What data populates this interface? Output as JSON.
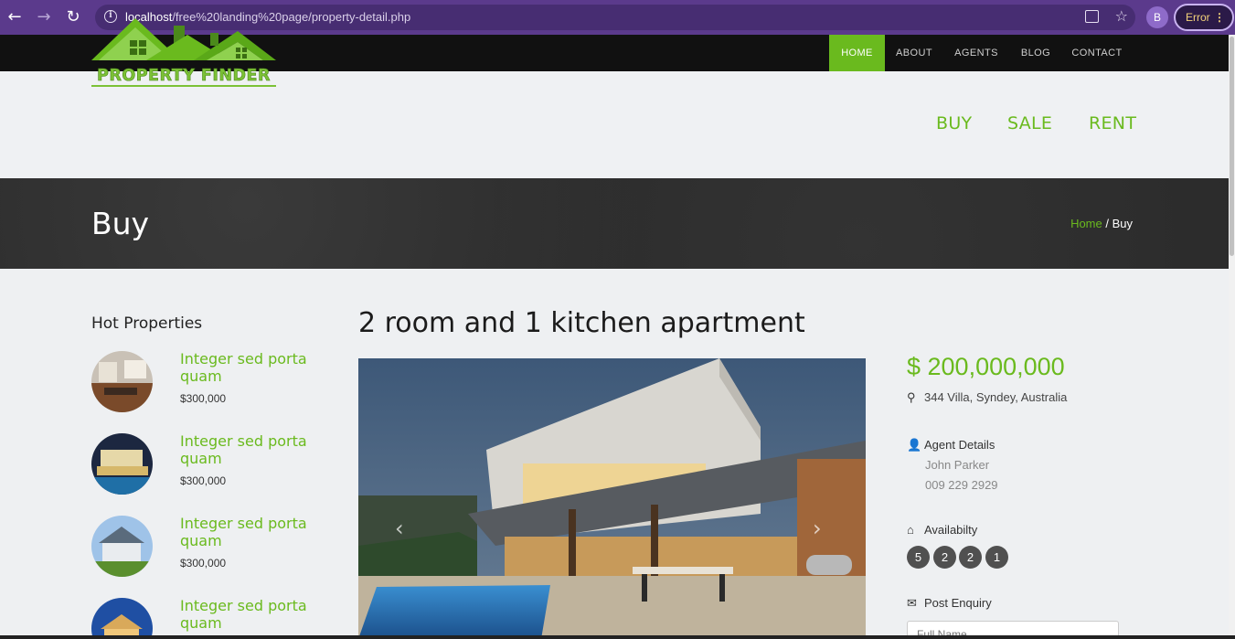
{
  "browser": {
    "url_host": "localhost",
    "url_path": "/free%20landing%20page/property-detail.php",
    "profile_initial": "B",
    "error_label": "Error"
  },
  "topnav": {
    "items": [
      "HOME",
      "ABOUT",
      "AGENTS",
      "BLOG",
      "CONTACT"
    ],
    "active_color": "#6aba1e"
  },
  "header": {
    "logo_text": "PROPERTY FINDER",
    "nav": [
      "BUY",
      "SALE",
      "RENT"
    ]
  },
  "page": {
    "title": "Buy",
    "breadcrumb_home": "Home",
    "breadcrumb_sep": " / ",
    "breadcrumb_current": "Buy"
  },
  "sidebar": {
    "title": "Hot Properties",
    "items": [
      {
        "name": "Integer sed porta quam",
        "price": "$300,000"
      },
      {
        "name": "Integer sed porta quam",
        "price": "$300,000"
      },
      {
        "name": "Integer sed porta quam",
        "price": "$300,000"
      },
      {
        "name": "Integer sed porta quam",
        "price": ""
      }
    ]
  },
  "property": {
    "title": "2 room and 1 kitchen apartment",
    "price": "$ 200,000,000",
    "address": "344 Villa, Syndey, Australia",
    "agent_heading": "Agent Details",
    "agent_name": "John Parker",
    "agent_phone": "009 229 2929",
    "availability_heading": "Availabilty",
    "availability": [
      "5",
      "2",
      "2",
      "1"
    ],
    "enquiry_heading": "Post Enquiry",
    "enquiry_placeholder": "Full Name"
  },
  "icons": {
    "back": "arrow-left-icon",
    "forward": "arrow-right-icon",
    "reload": "reload-icon",
    "pin": "map-pin-icon",
    "user": "user-icon",
    "home": "home-icon",
    "envelope": "envelope-icon"
  }
}
